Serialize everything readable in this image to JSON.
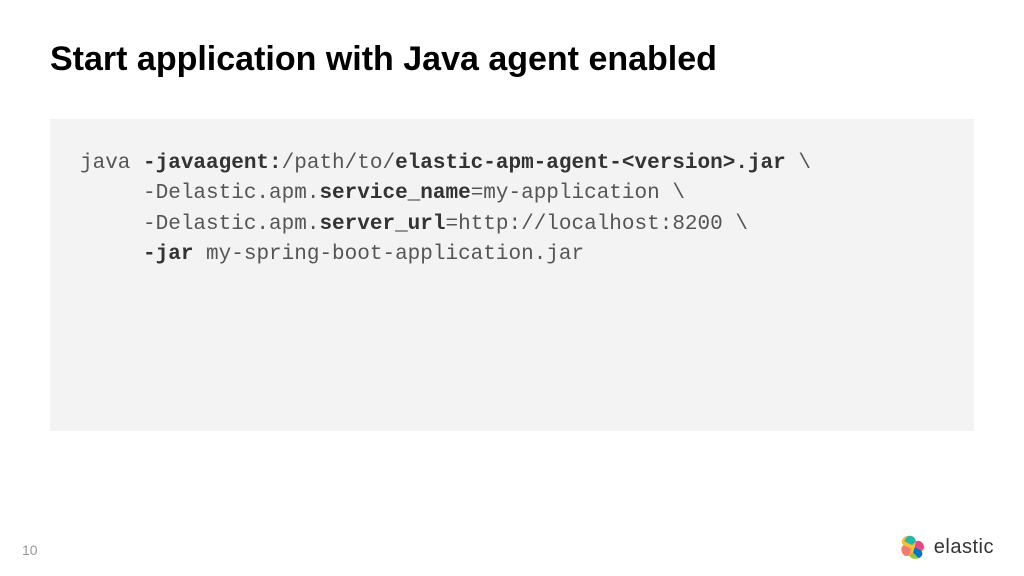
{
  "title": "Start application with Java agent enabled",
  "pageNumber": "10",
  "logoText": "elastic",
  "code": {
    "l1_a": "java ",
    "l1_b": "-javaagent:",
    "l1_c": "/path/to/",
    "l1_d": "elastic-apm-agent-<version>.jar",
    "l1_e": " \\",
    "l2_a": "     -Delastic.apm.",
    "l2_b": "service_name",
    "l2_c": "=my-application \\",
    "l3_a": "     -Delastic.apm.",
    "l3_b": "server_url",
    "l3_c": "=http://localhost:8200 \\",
    "l4_a": "     ",
    "l4_b": "-jar",
    "l4_c": " my-spring-boot-application.jar"
  }
}
